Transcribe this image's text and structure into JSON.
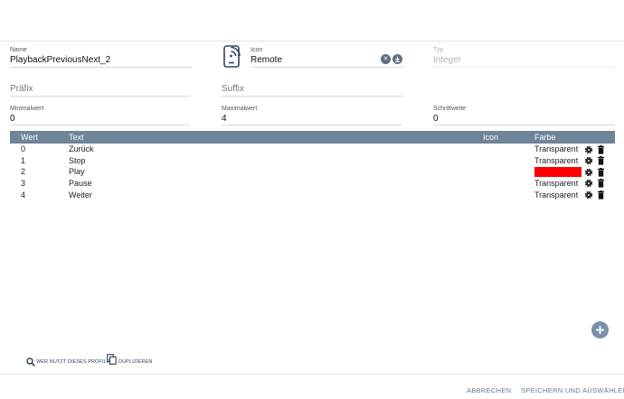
{
  "form": {
    "name": {
      "label": "Name",
      "value": "PlaybackPreviousNext_2"
    },
    "icon": {
      "label": "Icon",
      "value": "Remote",
      "icon": "remote-device-icon"
    },
    "typ": {
      "label": "Typ",
      "value": "Integer"
    },
    "praefix": {
      "placeholder": "Präfix"
    },
    "suffix": {
      "placeholder": "Suffix"
    },
    "minimalwert": {
      "label": "Minimalwert",
      "value": "0"
    },
    "maximalwert": {
      "label": "Maximalwert",
      "value": "4"
    },
    "schrittweite": {
      "label": "Schrittweite",
      "value": "0"
    }
  },
  "table": {
    "headers": {
      "wert": "Wert",
      "text": "Text",
      "icon": "Icon",
      "farbe": "Farbe"
    },
    "rows": [
      {
        "wert": "0",
        "text": "Zurück",
        "farbe": "Transparent"
      },
      {
        "wert": "1",
        "text": "Stop",
        "farbe": "Transparent"
      },
      {
        "wert": "2",
        "text": "Play",
        "farbe": "",
        "color": "#ff0000"
      },
      {
        "wert": "3",
        "text": "Pause",
        "farbe": "Transparent"
      },
      {
        "wert": "4",
        "text": "Weiter",
        "farbe": "Transparent"
      }
    ]
  },
  "actions": {
    "who_uses": "WER NUTZT DIESES PROFIL?",
    "duplicate": "DUPLIZIEREN"
  },
  "footer": {
    "cancel": "ABBRECHEN",
    "save": "SPEICHERN UND AUSWÄHLEN"
  },
  "colors": {
    "header_bg": "#6f8399",
    "accent": "#5d7b98",
    "fab": "#7a90a6"
  }
}
